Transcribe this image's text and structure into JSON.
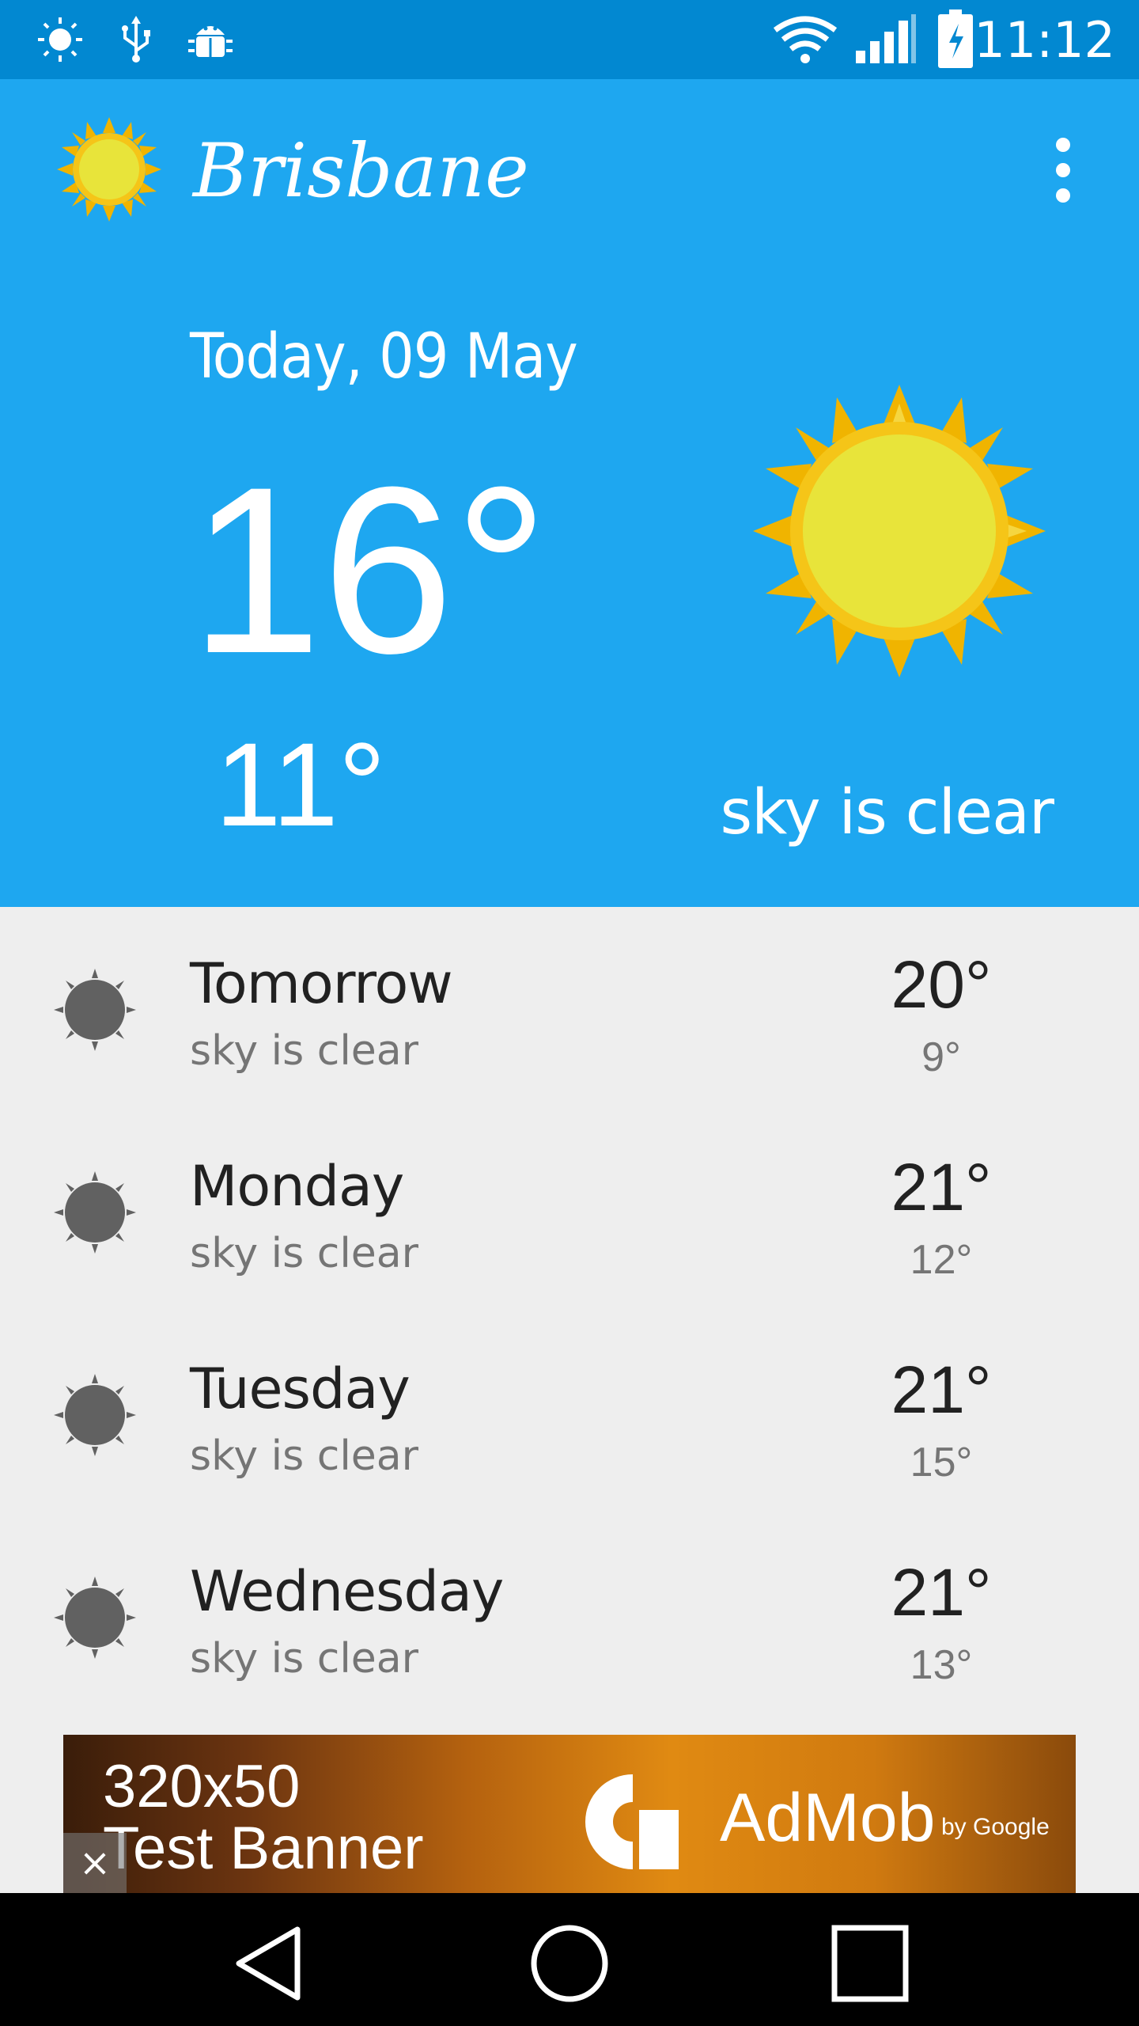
{
  "status_bar": {
    "time": "11:12",
    "left_icons": [
      "brightness-icon",
      "usb-icon",
      "android-debug-icon"
    ],
    "right_icons": [
      "wifi-icon",
      "signal-icon",
      "battery-charging-icon"
    ]
  },
  "app_bar": {
    "city": "Brisbane",
    "logo_icon": "sun-logo-icon",
    "menu_icon": "overflow-menu-icon"
  },
  "today": {
    "date": "Today, 09 May",
    "high": "16°",
    "low": "11°",
    "condition": "sky is clear",
    "icon": "clear-sky-icon"
  },
  "forecast": [
    {
      "day": "Tomorrow",
      "desc": "sky is clear",
      "hi": "20°",
      "lo": "9°",
      "icon": "clear-sky-icon"
    },
    {
      "day": "Monday",
      "desc": "sky is clear",
      "hi": "21°",
      "lo": "12°",
      "icon": "clear-sky-icon"
    },
    {
      "day": "Tuesday",
      "desc": "sky is clear",
      "hi": "21°",
      "lo": "15°",
      "icon": "clear-sky-icon"
    },
    {
      "day": "Wednesday",
      "desc": "sky is clear",
      "hi": "21°",
      "lo": "13°",
      "icon": "clear-sky-icon"
    }
  ],
  "ad": {
    "line1": "320x50",
    "line2": "Test Banner",
    "brand": "AdMob",
    "by": "by Google",
    "close": "×"
  },
  "nav_bar": {
    "buttons": [
      "back-icon",
      "home-icon",
      "recents-icon"
    ]
  },
  "colors": {
    "status_bar": "#0288d1",
    "hero": "#1ea7f0",
    "list_bg": "#eeeeee",
    "sun_outer": "#f5c518",
    "sun_inner": "#e8e43a"
  }
}
